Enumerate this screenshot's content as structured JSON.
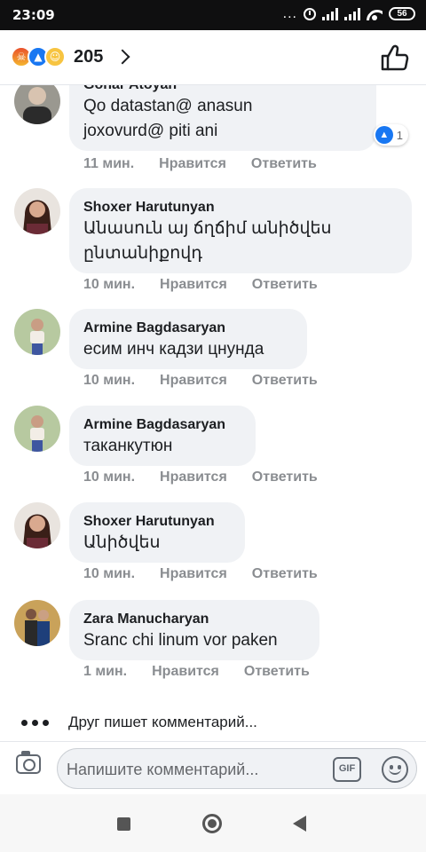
{
  "status_bar": {
    "time": "23:09",
    "battery": "56",
    "more": "..."
  },
  "header": {
    "reaction_count": "205",
    "reaction_icons": [
      "angry-icon",
      "like-icon",
      "haha-icon"
    ],
    "like_icon": "thumbs-up-outline-icon"
  },
  "comments": [
    {
      "author": "Gohar Atoyan",
      "lines": [
        "Qo datastan@ anasun",
        "joxovurd@ piti ani"
      ],
      "time": "11 мин.",
      "like_label": "Нравится",
      "reply_label": "Ответить",
      "likes": "1"
    },
    {
      "author": "Shoxer Harutunyan",
      "lines": [
        "Անասուն այ ճղճիմ անիծվես",
        "ընտանիքովդ"
      ],
      "time": "10 мин.",
      "like_label": "Нравится",
      "reply_label": "Ответить"
    },
    {
      "author": "Armine Bagdasaryan",
      "lines": [
        "есим инч кадзи цнунда"
      ],
      "time": "10 мин.",
      "like_label": "Нравится",
      "reply_label": "Ответить"
    },
    {
      "author": "Armine Bagdasaryan",
      "lines": [
        "таканкутюн"
      ],
      "time": "10 мин.",
      "like_label": "Нравится",
      "reply_label": "Ответить"
    },
    {
      "author": "Shoxer Harutunyan",
      "lines": [
        "Անիծվես"
      ],
      "time": "10 мин.",
      "like_label": "Нравится",
      "reply_label": "Ответить"
    },
    {
      "author": "Zara Manucharyan",
      "lines": [
        "Sranc chi linum vor paken"
      ],
      "time": "1 мин.",
      "like_label": "Нравится",
      "reply_label": "Ответить"
    }
  ],
  "typing_indicator": "Друг пишет комментарий...",
  "composer": {
    "placeholder": "Напишите комментарий...",
    "gif_label": "GIF"
  },
  "colors": {
    "accent": "#1877f2",
    "bubble": "#f0f2f5",
    "meta": "#8a8d91"
  }
}
